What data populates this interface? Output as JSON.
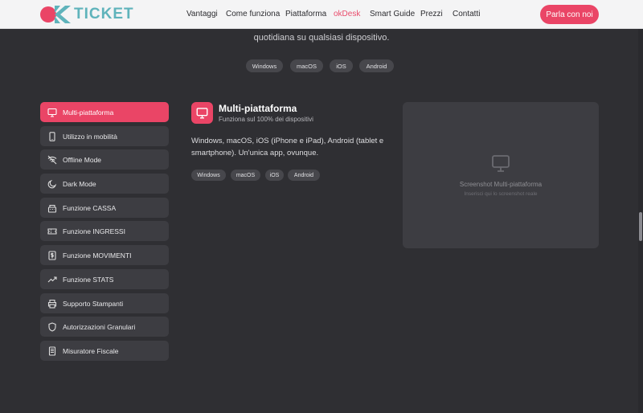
{
  "header": {
    "logo_text": "TICKET",
    "nav": [
      {
        "label": "Vantaggi"
      },
      {
        "label": "Come funziona"
      },
      {
        "label": "Piattaforma"
      },
      {
        "label": "okDesk"
      },
      {
        "label": "Smart Guide"
      },
      {
        "label": "Prezzi"
      },
      {
        "label": "Contatti"
      }
    ],
    "cta_label": "Parla con noi"
  },
  "intro": {
    "text": "quotidiana su qualsiasi dispositivo.",
    "platforms": [
      "Windows",
      "macOS",
      "iOS",
      "Android"
    ]
  },
  "sidebar": {
    "items": [
      {
        "label": "Multi-piattaforma",
        "icon": "monitor-icon"
      },
      {
        "label": "Utilizzo in mobilità",
        "icon": "smartphone-icon"
      },
      {
        "label": "Offline Mode",
        "icon": "wifi-off-icon"
      },
      {
        "label": "Dark Mode",
        "icon": "moon-icon"
      },
      {
        "label": "Funzione CASSA",
        "icon": "cash-register-icon"
      },
      {
        "label": "Funzione INGRESSI",
        "icon": "ticket-icon"
      },
      {
        "label": "Funzione MOVIMENTI",
        "icon": "dollar-icon"
      },
      {
        "label": "Funzione STATS",
        "icon": "trending-up-icon"
      },
      {
        "label": "Supporto Stampanti",
        "icon": "printer-icon"
      },
      {
        "label": "Autorizzazioni Granulari",
        "icon": "shield-icon"
      },
      {
        "label": "Misuratore Fiscale",
        "icon": "receipt-icon"
      }
    ]
  },
  "feature": {
    "title": "Multi-piattaforma",
    "subtitle": "Funziona sul 100% dei dispositivi",
    "description": "Windows, macOS, iOS (iPhone e iPad), Android (tablet e smartphone). Un'unica app, ovunque.",
    "chips": [
      "Windows",
      "macOS",
      "iOS",
      "Android"
    ]
  },
  "screenshot": {
    "title": "Screenshot Multi-piattaforma",
    "subtitle": "Inserisci qui lo screenshot reale"
  },
  "colors": {
    "accent": "#ea4566",
    "background": "#2f2f33",
    "card": "#3d3d42",
    "chip": "#47474c",
    "header": "#f4f4f5",
    "logo_teal": "#5fb3bb"
  }
}
